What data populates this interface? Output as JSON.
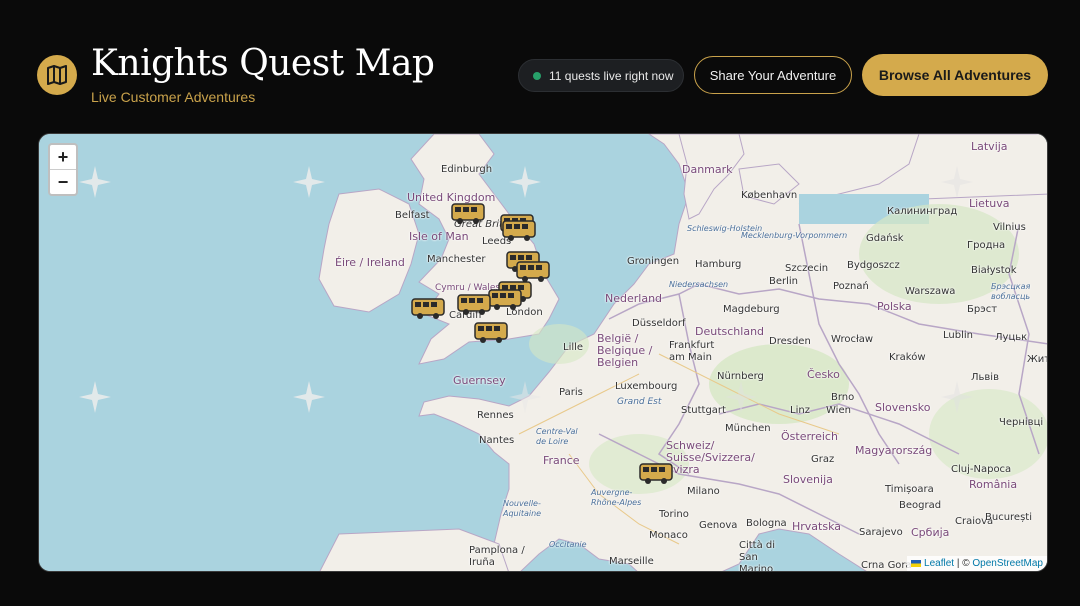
{
  "header": {
    "title": "Knights Quest Map",
    "subtitle": "Live Customer Adventures",
    "live_status": "11 quests live right now",
    "share_label": "Share Your Adventure",
    "browse_label": "Browse All Adventures"
  },
  "colors": {
    "accent": "#d4aa4c",
    "background": "#0a0a0a",
    "live_dot": "#27a06a",
    "sea": "#aad3df",
    "land": "#f2efe9"
  },
  "icons": {
    "logo": "book-map-icon",
    "marker": "bus-icon"
  },
  "map": {
    "zoom_in": "+",
    "zoom_out": "−",
    "attribution": {
      "leaflet": "Leaflet",
      "separator": " | © ",
      "osm": "OpenStreetMap"
    },
    "labels": [
      "Edinburgh",
      "United Kingdom",
      "Great Britain",
      "Belfast",
      "Isle of Man",
      "Éire / Ireland",
      "Leeds",
      "Manchester",
      "Cymru / Wales",
      "Cardiff",
      "London",
      "Guernsey",
      "Danmark",
      "København",
      "Schleswig-Holstein",
      "Mecklenburg-Vorpommern",
      "Hamburg",
      "Szczecin",
      "Bydgoszcz",
      "Gdańsk",
      "Калининград",
      "Lietuva",
      "Vilnius",
      "Latvija",
      "Гродна",
      "Białystok",
      "Niedersachsen",
      "Groningen",
      "Nederland",
      "Berlin",
      "Poznań",
      "Warszawa",
      "Polska",
      "Magdeburg",
      "Deutschland",
      "Düsseldorf",
      "België / Belgique / Belgien",
      "Lille",
      "Frankfurt am Main",
      "Dresden",
      "Wrocław",
      "Lublin",
      "Брэст",
      "Луцьк",
      "Kraków",
      "Česko",
      "Nürnberg",
      "Luxembourg",
      "Paris",
      "Grand Est",
      "Stuttgart",
      "Brno",
      "Wien",
      "Linz",
      "München",
      "Slovensko",
      "Львів",
      "Rennes",
      "Nantes",
      "Centre-Val de Loire",
      "Österreich",
      "Magyarország",
      "France",
      "Schweiz/ Suisse/Svizzera/ Svizra",
      "Graz",
      "Slovenija",
      "Cluj-Napoca",
      "România",
      "Milano",
      "Timișoara",
      "Nouvelle-Aquitaine",
      "Auvergne-Rhône-Alpes",
      "Torino",
      "Genova",
      "Bologna",
      "Hrvatska",
      "Beograd",
      "Србија",
      "Craiova",
      "București",
      "Monaco",
      "Città di San Marino",
      "Occitanie",
      "Sarajevo",
      "Pamplona / Iruña",
      "Marseille",
      "Crna Gora",
      "Чернівці",
      "Жит",
      "Брэсцкая вобласць"
    ]
  }
}
